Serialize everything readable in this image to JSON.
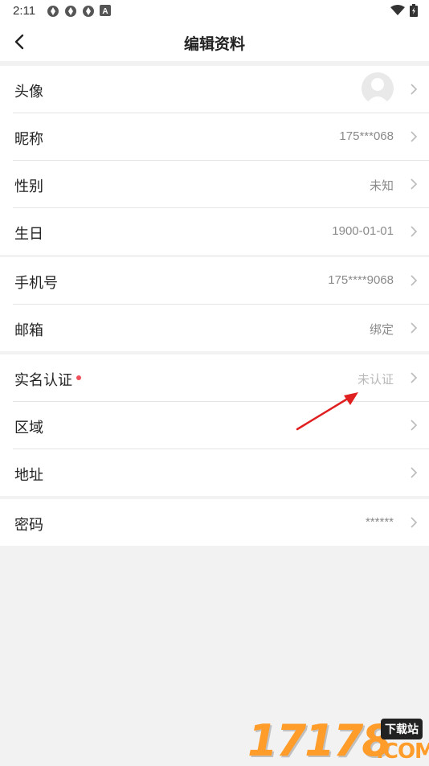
{
  "status_bar": {
    "time": "2:11",
    "notification_icons": [
      "vpn-icon",
      "vpn-icon",
      "vpn-icon",
      "a-badge-icon"
    ],
    "right_icons": [
      "wifi-icon",
      "battery-icon"
    ]
  },
  "header": {
    "title": "编辑资料",
    "back_icon": "chevron-left-icon"
  },
  "groups": [
    {
      "rows": [
        {
          "label": "头像",
          "value": "",
          "avatar": true
        },
        {
          "label": "昵称",
          "value": "175***068"
        },
        {
          "label": "性别",
          "value": "未知"
        },
        {
          "label": "生日",
          "value": "1900-01-01"
        }
      ]
    },
    {
      "rows": [
        {
          "label": "手机号",
          "value": "175****9068"
        },
        {
          "label": "邮箱",
          "value": "绑定"
        }
      ]
    },
    {
      "rows": [
        {
          "label": "实名认证",
          "value": "未认证",
          "red_dot": true
        },
        {
          "label": "区域",
          "value": ""
        },
        {
          "label": "地址",
          "value": ""
        }
      ]
    },
    {
      "rows": [
        {
          "label": "密码",
          "value": "******"
        }
      ]
    }
  ],
  "colors": {
    "accent_dot": "#f0505a",
    "arrow": "#e02020",
    "background": "#f2f2f2"
  },
  "watermark": {
    "digits": "17178",
    "badge": "下载站",
    "domain": ".COM"
  }
}
